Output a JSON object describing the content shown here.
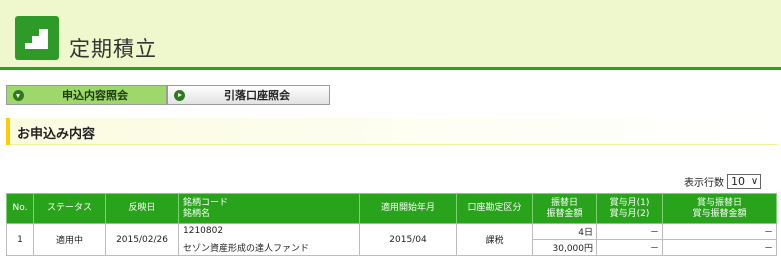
{
  "header": {
    "title": "定期積立",
    "logo_icon": "stairs-icon"
  },
  "tabs": [
    {
      "label": "申込内容照会",
      "active": true
    },
    {
      "label": "引落口座照会",
      "active": false
    }
  ],
  "section": {
    "title": "お申込み内容"
  },
  "rows_per_page": {
    "label": "表示行数",
    "value": "10"
  },
  "table": {
    "headers": {
      "no": "No.",
      "status": "ステータス",
      "reflect_date": "反映日",
      "code_line1": "銘柄コード",
      "code_line2": "銘柄名",
      "start_month": "適用開始年月",
      "account_type": "口座勘定区分",
      "transfer_line1": "振替日",
      "transfer_line2": "振替金額",
      "bonus_line1": "賞与月(1)",
      "bonus_line2": "賞与月(2)",
      "bonus_transfer_line1": "賞与振替日",
      "bonus_transfer_line2": "賞与振替金額"
    },
    "rows": [
      {
        "no": "1",
        "status": "適用中",
        "reflect_date": "2015/02/26",
        "code": "1210802",
        "name": "セゾン資産形成の達人ファンド",
        "start_month": "2015/04",
        "account_type": "課税",
        "transfer_day": "4日",
        "transfer_amount": "30,000円",
        "bonus_month1": "－",
        "bonus_month2": "－",
        "bonus_day": "－",
        "bonus_amount": "－"
      }
    ]
  },
  "colors": {
    "accent": "#2aa31c",
    "header_bg": "#eef8cc",
    "active_tab": "#9fd86a",
    "section_marker": "#ffcc00"
  }
}
